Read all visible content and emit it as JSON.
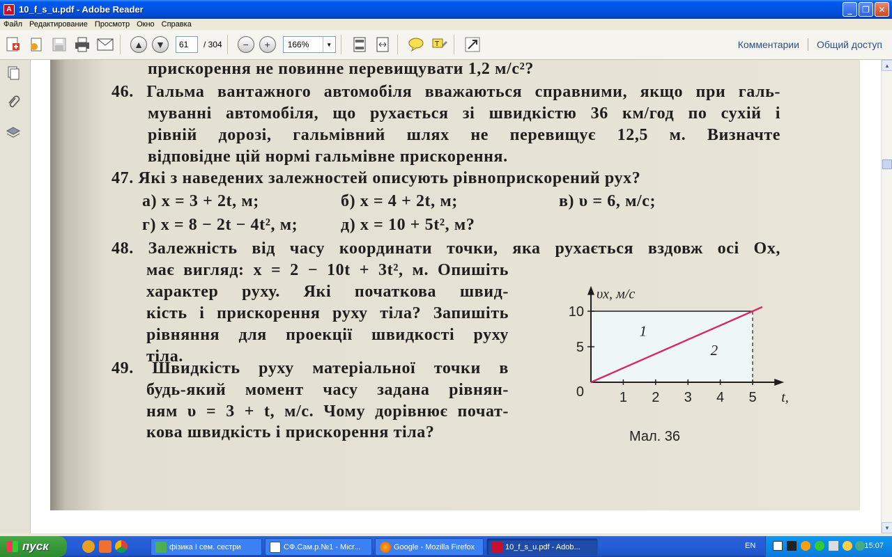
{
  "window": {
    "title": "10_f_s_u.pdf - Adobe Reader"
  },
  "menu": [
    "Файл",
    "Редактирование",
    "Просмотр",
    "Окно",
    "Справка"
  ],
  "toolbar": {
    "page_current": "61",
    "page_total": "/  304",
    "zoom": "166%",
    "comments_label": "Комментарии",
    "share_label": "Общий доступ"
  },
  "document": {
    "line0": "прискорення не повинне перевищувати 1,2 м/с²?",
    "p46": [
      "46. Гальма вантажного автомобіля вважаються справними, якщо при галь-",
      "муванні автомобіля, що рухається зі швидкістю 36 км/год по сухій і",
      "рівній дорозі, гальмівний шлях не перевищує 12,5 м. Визначте",
      "відповідне цій нормі гальмівне прискорення."
    ],
    "p47": "47. Які з наведених залежностей описують рівноприскорений рух?",
    "p47_options": {
      "a": "а) x = 3 + 2t, м;",
      "b": "б) x = 4 + 2t, м;",
      "v": "в) υ = 6, м/с;",
      "g": "г) x = 8 − 2t − 4t², м;",
      "d": "д) x = 10 + 5t², м?"
    },
    "p48": [
      "48. Залежність від часу координати точки, яка рухається вздовж осі Ox,",
      "має вигляд: x = 2 − 10t + 3t², м. Опишіть",
      "характер руху. Які початкова швид-",
      "кість і прискорення руху тіла? Запишіть",
      "рівняння для проекції швидкості руху",
      "тіла."
    ],
    "p49": [
      "49. Швидкість руху матеріальної точки в",
      "будь-який момент часу задана рівнян-",
      "ням υ = 3 + t, м/с. Чому дорівнює почат-",
      "кова швидкість і прискорення тіла?"
    ],
    "figure_caption": "Мал. 36"
  },
  "chart_data": {
    "type": "line",
    "ylabel": "υx, м/с",
    "xlabel": "t, с",
    "origin_label": "0",
    "x_ticks": [
      1,
      2,
      3,
      4,
      5
    ],
    "y_ticks": [
      5,
      10
    ],
    "xlim": [
      0,
      5.5
    ],
    "ylim": [
      0,
      12
    ],
    "series": [
      {
        "name": "1",
        "x": [
          0,
          5.3
        ],
        "y": [
          10,
          10
        ],
        "color": "#1e1e1e"
      },
      {
        "name": "2",
        "x": [
          0,
          5.3
        ],
        "y": [
          0,
          10.6
        ],
        "color": "#d8286a"
      }
    ],
    "region_labels": [
      {
        "text": "1",
        "x": 1.5,
        "y": 6.5
      },
      {
        "text": "2",
        "x": 3.7,
        "y": 3.8
      }
    ],
    "guide": {
      "x": 5,
      "y": 10
    }
  },
  "taskbar": {
    "start_label": "пуск",
    "tasks": [
      "фізика І сем. сестри",
      "СФ.Сам.р.№1 - Micr...",
      "Google - Mozilla Firefox",
      "10_f_s_u.pdf - Adob..."
    ],
    "language": "EN",
    "clock": "15:07"
  },
  "colors": {
    "accent": "#0054e3",
    "graph_line": "#d8286a"
  }
}
